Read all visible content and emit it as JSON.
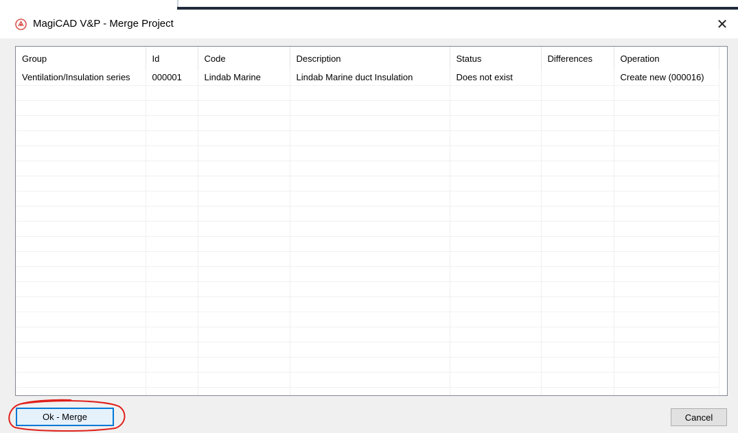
{
  "window": {
    "title": "MagiCAD V&P - Merge Project",
    "close_glyph": "✕",
    "icon": "magicad-logo-icon"
  },
  "grid": {
    "columns": [
      "Group",
      "Id",
      "Code",
      "Description",
      "Status",
      "Differences",
      "Operation"
    ],
    "rows": [
      [
        "Ventilation/Insulation series",
        "000001",
        "Lindab Marine",
        "Lindab Marine duct Insulation",
        "Does not exist",
        "",
        "Create new (000016)"
      ]
    ]
  },
  "buttons": {
    "ok_label": "Ok - Merge",
    "cancel_label": "Cancel"
  },
  "colors": {
    "accent": "#0078d7",
    "annotation": "#e0201c"
  }
}
